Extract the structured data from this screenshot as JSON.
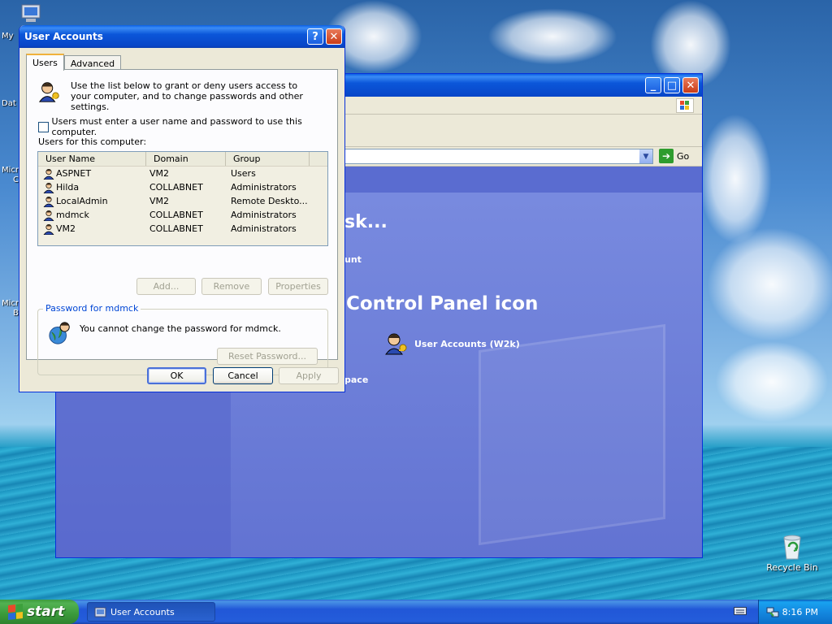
{
  "desktop": {
    "icons": [
      {
        "label": "My"
      },
      {
        "label": "Dat"
      },
      {
        "label": "Micro"
      },
      {
        "label": "C"
      },
      {
        "label": "Micro"
      },
      {
        "label": "B"
      }
    ],
    "recycle_bin": "Recycle Bin"
  },
  "control_panel": {
    "text_fragment_1": "sk...",
    "text_fragment_2": "unt",
    "heading": "Control Panel icon",
    "item_label": "User Accounts (W2k)",
    "text_fragment_3": "pace",
    "go_label": "Go"
  },
  "dialog": {
    "title": "User Accounts",
    "tabs": [
      "Users",
      "Advanced"
    ],
    "intro": "Use the list below to grant or deny users access to your computer, and to change passwords and other settings.",
    "checkbox_label": "Users must enter a user name and password to use this computer.",
    "users_label": "Users for this computer:",
    "columns": [
      "User Name",
      "Domain",
      "Group"
    ],
    "rows": [
      {
        "name": "ASPNET",
        "domain": "VM2",
        "group": "Users"
      },
      {
        "name": "Hilda",
        "domain": "COLLABNET",
        "group": "Administrators"
      },
      {
        "name": "LocalAdmin",
        "domain": "VM2",
        "group": "Remote Deskto..."
      },
      {
        "name": "mdmck",
        "domain": "COLLABNET",
        "group": "Administrators"
      },
      {
        "name": "VM2",
        "domain": "COLLABNET",
        "group": "Administrators"
      }
    ],
    "buttons": {
      "add": "Add...",
      "remove": "Remove",
      "properties": "Properties"
    },
    "password_group": {
      "legend": "Password for mdmck",
      "message": "You cannot change the password for mdmck.",
      "reset": "Reset Password..."
    },
    "footer": {
      "ok": "OK",
      "cancel": "Cancel",
      "apply": "Apply"
    }
  },
  "taskbar": {
    "start": "start",
    "task_item": "User Accounts",
    "clock": "8:16 PM"
  }
}
